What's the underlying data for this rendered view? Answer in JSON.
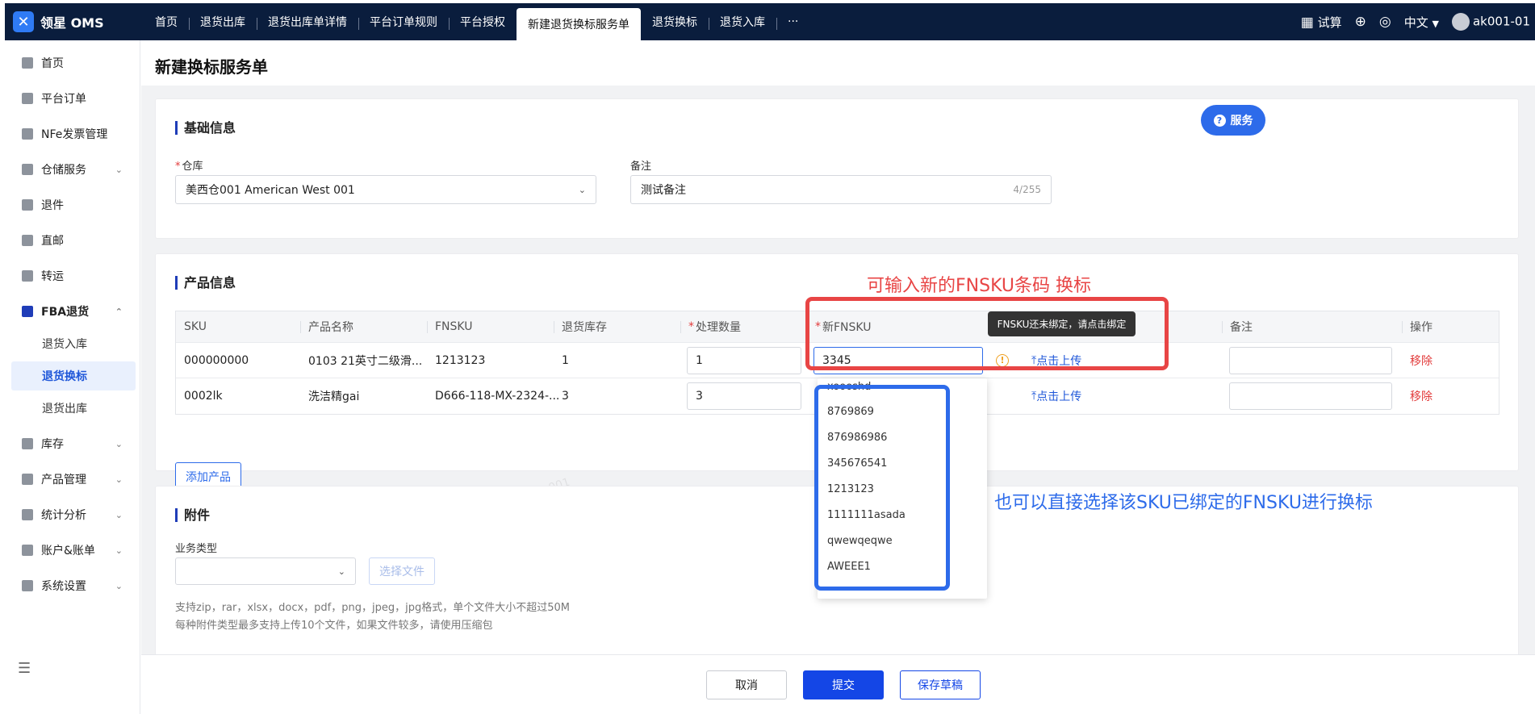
{
  "app": {
    "name": "领星 OMS",
    "logo_icon": "lingxing-logo-icon"
  },
  "top_tabs": [
    {
      "label": "首页"
    },
    {
      "label": "退货出库"
    },
    {
      "label": "退货出库单详情"
    },
    {
      "label": "平台订单规则"
    },
    {
      "label": "平台授权"
    },
    {
      "label": "新建退货换标服务单",
      "active": true
    },
    {
      "label": "退货换标"
    },
    {
      "label": "退货入库"
    },
    {
      "label": "···"
    }
  ],
  "top_right": {
    "calc": "试算",
    "language": "中文",
    "user": "ak001-01"
  },
  "sidebar": {
    "items": [
      {
        "label": "首页",
        "icon": "home-icon"
      },
      {
        "label": "平台订单",
        "icon": "order-icon"
      },
      {
        "label": "NFe发票管理",
        "icon": "invoice-icon"
      },
      {
        "label": "仓储服务",
        "icon": "warehouse-icon",
        "expandable": true
      },
      {
        "label": "退件",
        "icon": "return-icon"
      },
      {
        "label": "直邮",
        "icon": "direct-mail-icon"
      },
      {
        "label": "转运",
        "icon": "transfer-icon"
      },
      {
        "label": "FBA退货",
        "icon": "fba-icon",
        "expanded": true
      },
      {
        "label": "库存",
        "icon": "inventory-icon",
        "expandable": true
      },
      {
        "label": "产品管理",
        "icon": "product-icon",
        "expandable": true
      },
      {
        "label": "统计分析",
        "icon": "stats-icon",
        "expandable": true
      },
      {
        "label": "账户&账单",
        "icon": "account-icon",
        "expandable": true
      },
      {
        "label": "系统设置",
        "icon": "settings-icon",
        "expandable": true
      }
    ],
    "fba_sub": [
      {
        "label": "退货入库"
      },
      {
        "label": "退货换标",
        "active": true
      },
      {
        "label": "退货出库"
      }
    ]
  },
  "page": {
    "title": "新建换标服务单",
    "service_button": "服务"
  },
  "basic_info": {
    "title": "基础信息",
    "warehouse_label": "仓库",
    "warehouse_value": "美西仓001 American West 001",
    "remark_label": "备注",
    "remark_value": "测试备注",
    "remark_counter": "4/255"
  },
  "product_info": {
    "title": "产品信息",
    "columns": [
      "SKU",
      "产品名称",
      "FNSKU",
      "退货库存",
      "处理数量",
      "新FNSKU",
      "",
      "备注",
      "操作"
    ],
    "rows": [
      {
        "sku": "000000000",
        "name": "0103 21英寸二级滑...",
        "fnsku": "1213123",
        "stock": "1",
        "qty": "1",
        "new_fnsku": "3345",
        "upload": "点击上传",
        "action": "移除"
      },
      {
        "sku": "0002lk",
        "name": "洗洁精gai",
        "fnsku": "D666-118-MX-2324-...",
        "stock": "3",
        "qty": "3",
        "new_fnsku": "",
        "upload": "点击上传",
        "action": "移除"
      }
    ],
    "add_button": "添加产品",
    "tooltip": "FNSKU还未绑定，请点击绑定",
    "fnsku_options": [
      "xoooshd",
      "8769869",
      "876986986",
      "345676541",
      "1213123",
      "1111111asada",
      "qwewqeqwe",
      "AWEEE1"
    ]
  },
  "attachments": {
    "title": "附件",
    "type_label": "业务类型",
    "choose_file": "选择文件",
    "hint1": "支持zip，rar，xlsx，docx，pdf，png，jpeg，jpg格式，单个文件大小不超过50M",
    "hint2": "每种附件类型最多支持上传10个文件，如果文件较多，请使用压缩包"
  },
  "annotations": {
    "red": "可输入新的FNSKU条码 换标",
    "blue": "也可以直接选择该SKU已绑定的FNSKU进行换标"
  },
  "footer": {
    "cancel": "取消",
    "submit": "提交",
    "save_draft": "保存草稿"
  },
  "watermark": "ak001-01_100s001",
  "colors": {
    "topbar": "#0a1d3d",
    "primary": "#2d6bea",
    "danger": "#e23b3b",
    "annotation_red": "#e84545"
  }
}
